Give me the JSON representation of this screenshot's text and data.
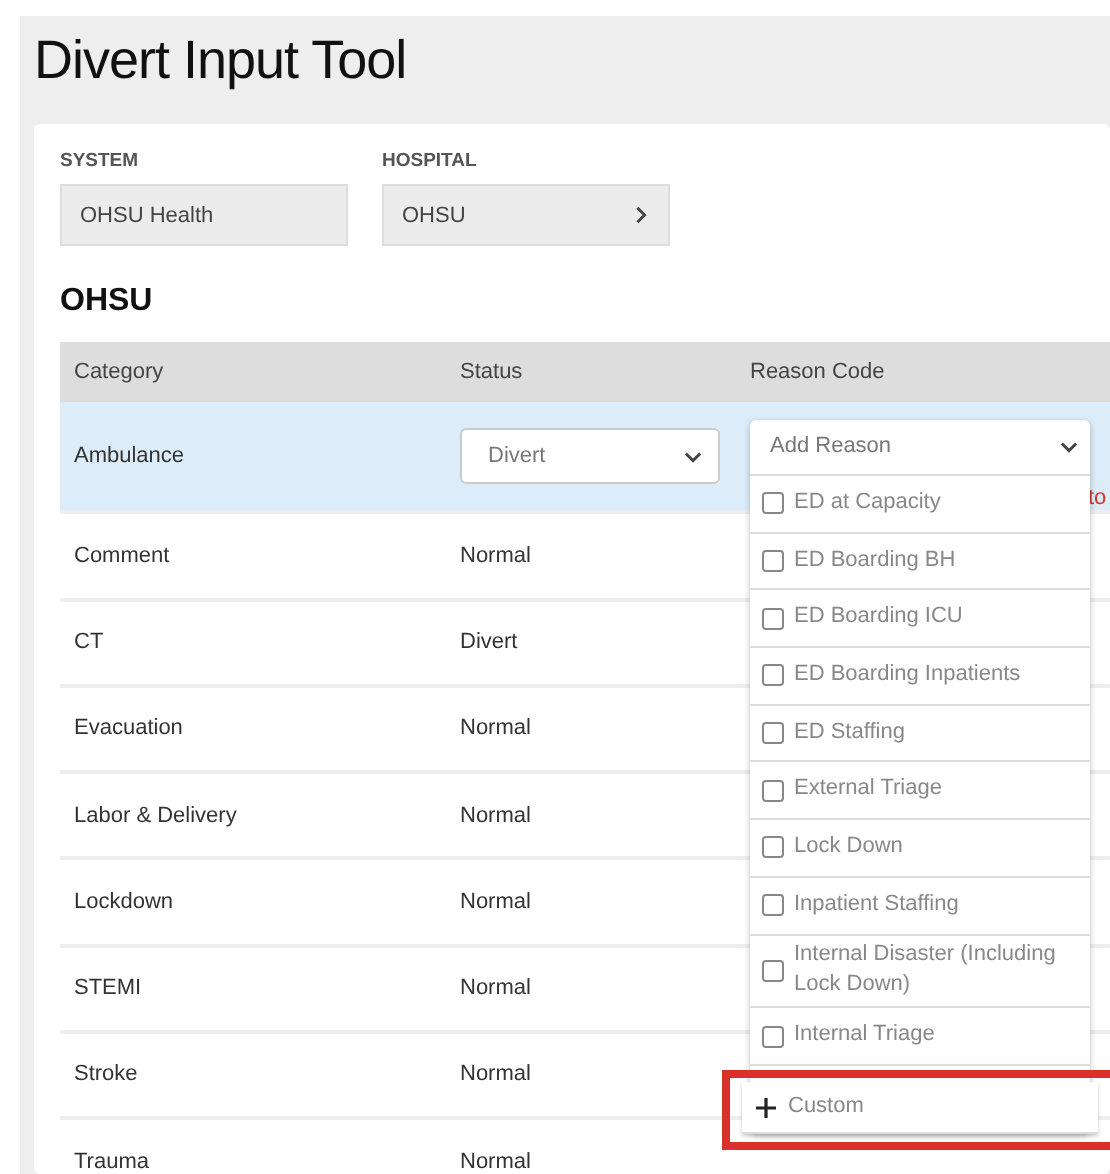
{
  "title": "Divert Input Tool",
  "filters": [
    {
      "label": "SYSTEM",
      "value": "OHSU Health",
      "has_chevron": false
    },
    {
      "label": "HOSPITAL",
      "value": "OHSU",
      "has_chevron": true
    }
  ],
  "section_title": "OHSU",
  "table": {
    "columns": [
      "Category",
      "Status",
      "Reason Code"
    ],
    "rows": [
      {
        "category": "Ambulance",
        "status": "Divert",
        "editing": true,
        "note": "to"
      },
      {
        "category": "Comment",
        "status": "Normal",
        "editing": false
      },
      {
        "category": "CT",
        "status": "Divert",
        "editing": false
      },
      {
        "category": "Evacuation",
        "status": "Normal",
        "editing": false
      },
      {
        "category": "Labor & Delivery",
        "status": "Normal",
        "editing": false
      },
      {
        "category": "Lockdown",
        "status": "Normal",
        "editing": false
      },
      {
        "category": "STEMI",
        "status": "Normal",
        "editing": false
      },
      {
        "category": "Stroke",
        "status": "Normal",
        "editing": false
      },
      {
        "category": "Trauma",
        "status": "Normal",
        "editing": false
      }
    ]
  },
  "reason_dropdown": {
    "placeholder": "Add Reason",
    "options": [
      {
        "label": "ED at Capacity",
        "checked": false
      },
      {
        "label": "ED Boarding BH",
        "checked": false
      },
      {
        "label": "ED Boarding ICU",
        "checked": false
      },
      {
        "label": "ED Boarding Inpatients",
        "checked": false
      },
      {
        "label": "ED Staffing",
        "checked": false
      },
      {
        "label": "External Triage",
        "checked": false
      },
      {
        "label": "Lock Down",
        "checked": false
      },
      {
        "label": "Inpatient Staffing",
        "checked": false
      },
      {
        "label": "Internal Disaster (Including Lock Down)",
        "checked": false
      },
      {
        "label": "Internal Triage",
        "checked": false
      }
    ],
    "custom": {
      "label": "Custom",
      "highlighted": true
    }
  }
}
